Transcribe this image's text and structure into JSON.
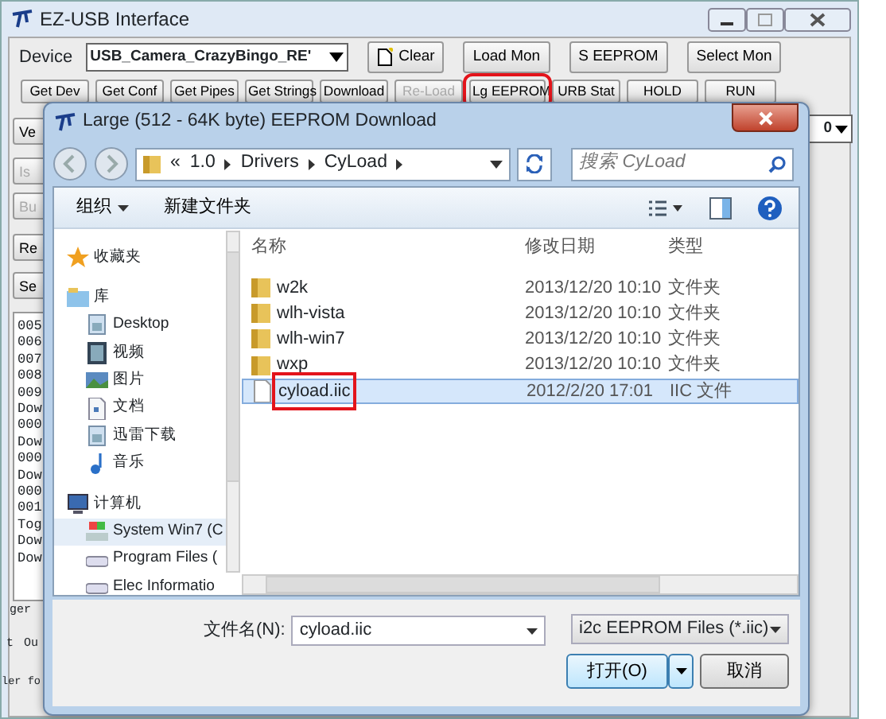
{
  "main_window": {
    "title": "EZ-USB Interface",
    "device_label": "Device",
    "device": "USB_Camera_CrazyBingo_RE'",
    "top_buttons": [
      {
        "label": "Clear",
        "kind": "icon"
      },
      {
        "label": "Load Mon",
        "kind": "plain"
      },
      {
        "label": "S EEPROM",
        "kind": "plain"
      },
      {
        "label": "Select Mon",
        "kind": "plain"
      }
    ],
    "toolbar_buttons": [
      {
        "label": "Get Dev",
        "disabled": false,
        "highlighted": false
      },
      {
        "label": "Get Conf",
        "disabled": false,
        "highlighted": false
      },
      {
        "label": "Get Pipes",
        "disabled": false,
        "highlighted": false
      },
      {
        "label": "Get Strings",
        "disabled": false,
        "highlighted": false
      },
      {
        "label": "Download",
        "disabled": false,
        "highlighted": false
      },
      {
        "label": "Re-Load",
        "disabled": true,
        "highlighted": false
      },
      {
        "label": "Lg EEPROM",
        "disabled": false,
        "highlighted": true
      },
      {
        "label": "URB Stat",
        "disabled": false,
        "highlighted": false
      },
      {
        "label": "HOLD",
        "disabled": false,
        "highlighted": false
      },
      {
        "label": "RUN",
        "disabled": false,
        "highlighted": false
      }
    ],
    "side_buttons": [
      {
        "label": "Ve",
        "disabled": false
      },
      {
        "label": "Is",
        "disabled": true
      },
      {
        "label": "Bu",
        "disabled": true
      },
      {
        "label": "Re",
        "disabled": false
      },
      {
        "label": "Se",
        "disabled": false
      }
    ],
    "right_value": "0",
    "log_lines": [
      "005",
      "006",
      "007",
      "008",
      "009",
      "Dow",
      "000",
      "Dow",
      "000",
      "Dow",
      "000",
      "001",
      "Tog",
      "Dow",
      "Dow"
    ],
    "bottom_texts": [
      "ger",
      "t",
      "Ou",
      "ler fo"
    ]
  },
  "dialog": {
    "title": "Large (512 - 64K byte) EEPROM Download",
    "breadcrumb": [
      "«",
      "1.0",
      "Drivers",
      "CyLoad"
    ],
    "search": {
      "placeholder": "搜索 CyLoad"
    },
    "organize": "组织",
    "new_folder": "新建文件夹",
    "nav_items": [
      {
        "label": "收藏夹",
        "kind": "favorites",
        "selected": false
      },
      {
        "label": "库",
        "kind": "library",
        "selected": false,
        "children": [
          {
            "label": "Desktop",
            "kind": "desktop",
            "selected": false
          },
          {
            "label": "视频",
            "kind": "video",
            "selected": false
          },
          {
            "label": "图片",
            "kind": "pictures",
            "selected": false
          },
          {
            "label": "文档",
            "kind": "documents",
            "selected": false
          },
          {
            "label": "迅雷下载",
            "kind": "desktop",
            "selected": false
          },
          {
            "label": "音乐",
            "kind": "music",
            "selected": false
          }
        ]
      },
      {
        "label": "计算机",
        "kind": "computer",
        "selected": false,
        "children": [
          {
            "label": "System Win7 (C",
            "kind": "drive",
            "selected": true
          },
          {
            "label": "Program Files (",
            "kind": "disk",
            "selected": false
          },
          {
            "label": "Elec Informatio",
            "kind": "disk",
            "selected": false
          }
        ]
      }
    ],
    "columns": [
      "名称",
      "修改日期",
      "类型"
    ],
    "files": [
      {
        "name": "w2k",
        "modified": "2013/12/20 10:10",
        "type": "文件夹",
        "kind": "folder",
        "selected": false,
        "highlighted": false
      },
      {
        "name": "wlh-vista",
        "modified": "2013/12/20 10:10",
        "type": "文件夹",
        "kind": "folder",
        "selected": false,
        "highlighted": false
      },
      {
        "name": "wlh-win7",
        "modified": "2013/12/20 10:10",
        "type": "文件夹",
        "kind": "folder",
        "selected": false,
        "highlighted": false
      },
      {
        "name": "wxp",
        "modified": "2013/12/20 10:10",
        "type": "文件夹",
        "kind": "folder",
        "selected": false,
        "highlighted": false
      },
      {
        "name": "cyload.iic",
        "modified": "2012/2/20 17:01",
        "type": "IIC 文件",
        "kind": "file",
        "selected": true,
        "highlighted": true
      }
    ],
    "filename_label": "文件名(N):",
    "filename": "cyload.iic",
    "filter": "i2c EEPROM Files (*.iic)",
    "open": "打开(O)",
    "cancel": "取消"
  }
}
